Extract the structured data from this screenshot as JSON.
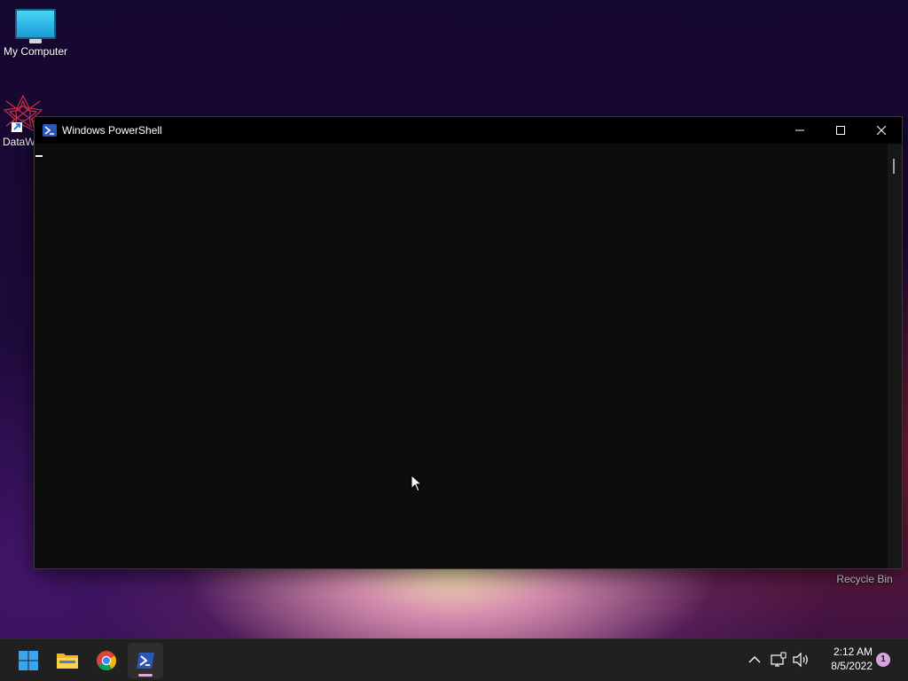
{
  "desktop": {
    "icons": [
      {
        "label": "My Computer",
        "icon": "monitor-icon"
      },
      {
        "label": "DataW",
        "icon": "datawrapper-app-icon"
      }
    ],
    "recycle_bin_label": "Recycle Bin"
  },
  "window": {
    "title": "Windows PowerShell",
    "icon": "powershell-icon",
    "controls": [
      "minimize-icon",
      "maximize-icon",
      "close-icon"
    ]
  },
  "taskbar": {
    "apps": [
      {
        "name": "Start",
        "icon": "windows-start-icon"
      },
      {
        "name": "File Explorer",
        "icon": "folder-icon"
      },
      {
        "name": "Google Chrome",
        "icon": "chrome-icon"
      },
      {
        "name": "Windows PowerShell",
        "icon": "powershell-icon",
        "active": true
      }
    ],
    "tray": {
      "icons": [
        "chevron-up-icon",
        "network-icon",
        "speaker-icon"
      ],
      "time": "2:12 AM",
      "date": "8/5/2022",
      "notification_count": "1"
    }
  },
  "colors": {
    "console_bg": "#0c0c0c",
    "taskbar_bg": "#202020",
    "accent_indicator": "#e0a8d8",
    "powershell_blue": "#2c56b8"
  }
}
